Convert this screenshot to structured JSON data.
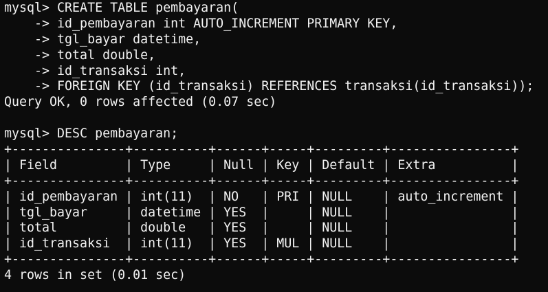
{
  "terminal": {
    "lines": [
      "mysql> CREATE TABLE pembayaran(",
      "    -> id_pembayaran int AUTO_INCREMENT PRIMARY KEY,",
      "    -> tgl_bayar datetime,",
      "    -> total double,",
      "    -> id_transaksi int,",
      "    -> FOREIGN KEY (id_transaksi) REFERENCES transaksi(id_transaksi));",
      "Query OK, 0 rows affected (0.07 sec)",
      "",
      "mysql> DESC pembayaran;",
      "+---------------+----------+------+-----+---------+----------------+",
      "| Field         | Type     | Null | Key | Default | Extra          |",
      "+---------------+----------+------+-----+---------+----------------+",
      "| id_pembayaran | int(11)  | NO   | PRI | NULL    | auto_increment |",
      "| tgl_bayar     | datetime | YES  |     | NULL    |                |",
      "| total         | double   | YES  |     | NULL    |                |",
      "| id_transaksi  | int(11)  | YES  | MUL | NULL    |                |",
      "+---------------+----------+------+-----+---------+----------------+",
      "4 rows in set (0.01 sec)"
    ]
  },
  "colors": {
    "background": "#0c0c0c",
    "text": "#f2f2f2"
  }
}
